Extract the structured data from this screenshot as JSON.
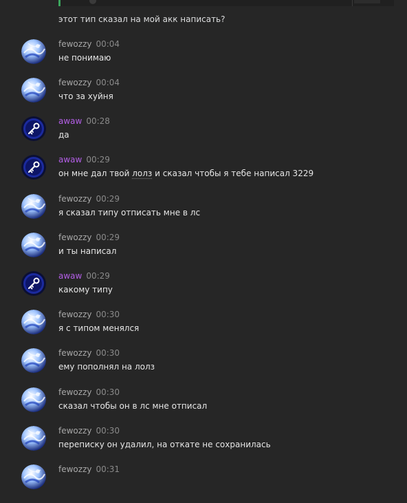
{
  "top_message": {
    "text": "этот тип сказал на мой акк написать?"
  },
  "messages": [
    {
      "author": "fewozzy",
      "time": "00:04",
      "text": "не понимаю",
      "avatar": "sphere",
      "color": "#a8a8a8"
    },
    {
      "author": "fewozzy",
      "time": "00:04",
      "text": "что за хуйня",
      "avatar": "sphere",
      "color": "#a8a8a8"
    },
    {
      "author": "awaw",
      "time": "00:28",
      "text": "да",
      "avatar": "key",
      "color": "#b35ee6"
    },
    {
      "author": "awaw",
      "time": "00:29",
      "text_pre": "он мне дал твой ",
      "text_link": "лолз",
      "text_post": " и сказал чтобы я тебе написал 3229",
      "avatar": "key",
      "color": "#b35ee6"
    },
    {
      "author": "fewozzy",
      "time": "00:29",
      "text": "я сказал типу отписать мне в лс",
      "avatar": "sphere",
      "color": "#a8a8a8"
    },
    {
      "author": "fewozzy",
      "time": "00:29",
      "text": "и ты написал",
      "avatar": "sphere",
      "color": "#a8a8a8"
    },
    {
      "author": "awaw",
      "time": "00:29",
      "text": "какому типу",
      "avatar": "key",
      "color": "#b35ee6"
    },
    {
      "author": "fewozzy",
      "time": "00:30",
      "text": "я с типом менялся",
      "avatar": "sphere",
      "color": "#a8a8a8"
    },
    {
      "author": "fewozzy",
      "time": "00:30",
      "text": "ему пополнял на лолз",
      "avatar": "sphere",
      "color": "#a8a8a8"
    },
    {
      "author": "fewozzy",
      "time": "00:30",
      "text": "сказал чтобы он в лс мне отписал",
      "avatar": "sphere",
      "color": "#a8a8a8"
    },
    {
      "author": "fewozzy",
      "time": "00:30",
      "text": "переписку он удалил, на откате не сохранилась",
      "avatar": "sphere",
      "color": "#a8a8a8"
    },
    {
      "author": "fewozzy",
      "time": "00:31",
      "text": "",
      "avatar": "sphere",
      "color": "#a8a8a8"
    }
  ]
}
